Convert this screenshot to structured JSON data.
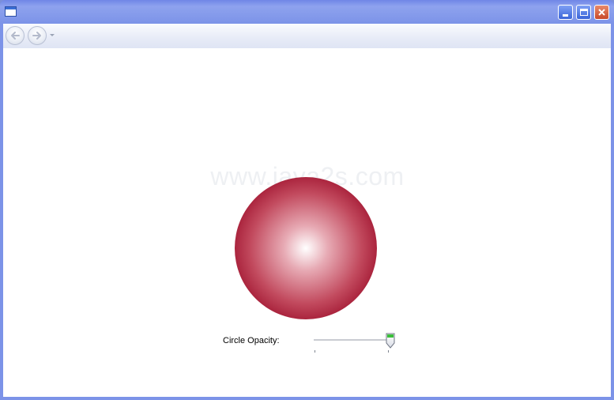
{
  "window": {
    "title": "",
    "icon": "window-icon",
    "controls": {
      "minimize_icon": "minimize-icon",
      "maximize_icon": "maximize-icon",
      "close_icon": "close-icon"
    }
  },
  "navigation": {
    "back_icon": "back-arrow-icon",
    "forward_icon": "forward-arrow-icon",
    "history_dropdown_icon": "chevron-down-icon"
  },
  "content": {
    "watermark": "www.java2s.com",
    "circle": {
      "fill_center": "#ffffff",
      "fill_edge": "#8b0020"
    },
    "opacity_control": {
      "label": "Circle Opacity:",
      "value": 1,
      "min": 0,
      "max": 1
    }
  },
  "colors": {
    "titlebar": "#7c93e8",
    "close_button": "#c8492a",
    "slider_thumb_accent": "#3bbf3b"
  }
}
